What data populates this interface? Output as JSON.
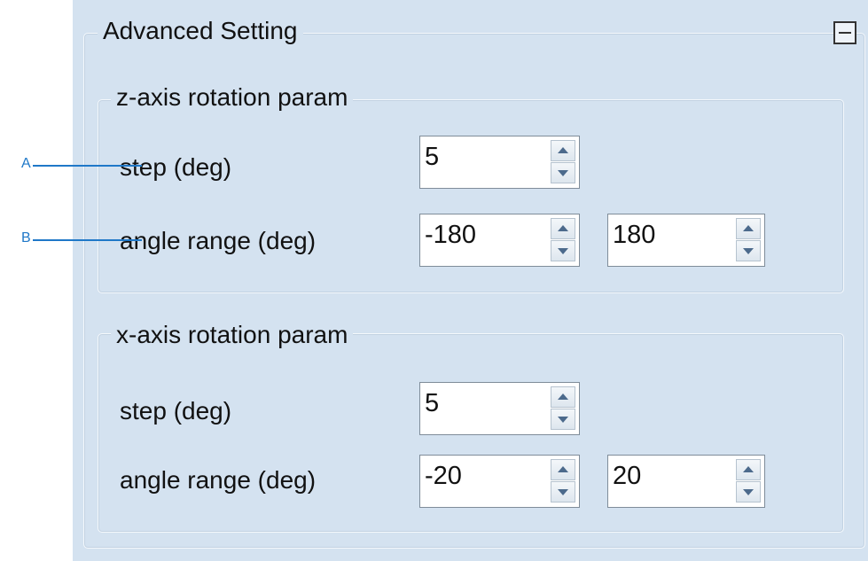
{
  "advanced": {
    "title": "Advanced Setting",
    "collapse_icon": "collapse-minus-icon"
  },
  "z_axis": {
    "title": "z-axis rotation param",
    "step_label": "step (deg)",
    "step_value": "5",
    "range_label": "angle range (deg)",
    "range_min": "-180",
    "range_max": "180"
  },
  "x_axis": {
    "title": "x-axis rotation param",
    "step_label": "step (deg)",
    "step_value": "5",
    "range_label": "angle range (deg)",
    "range_min": "-20",
    "range_max": "20"
  },
  "callouts": {
    "a": "A",
    "b": "B",
    "color": "#1f78c8"
  },
  "colors": {
    "panel_background": "#d4e2f0",
    "spin_arrow": "#4c6a8c"
  }
}
